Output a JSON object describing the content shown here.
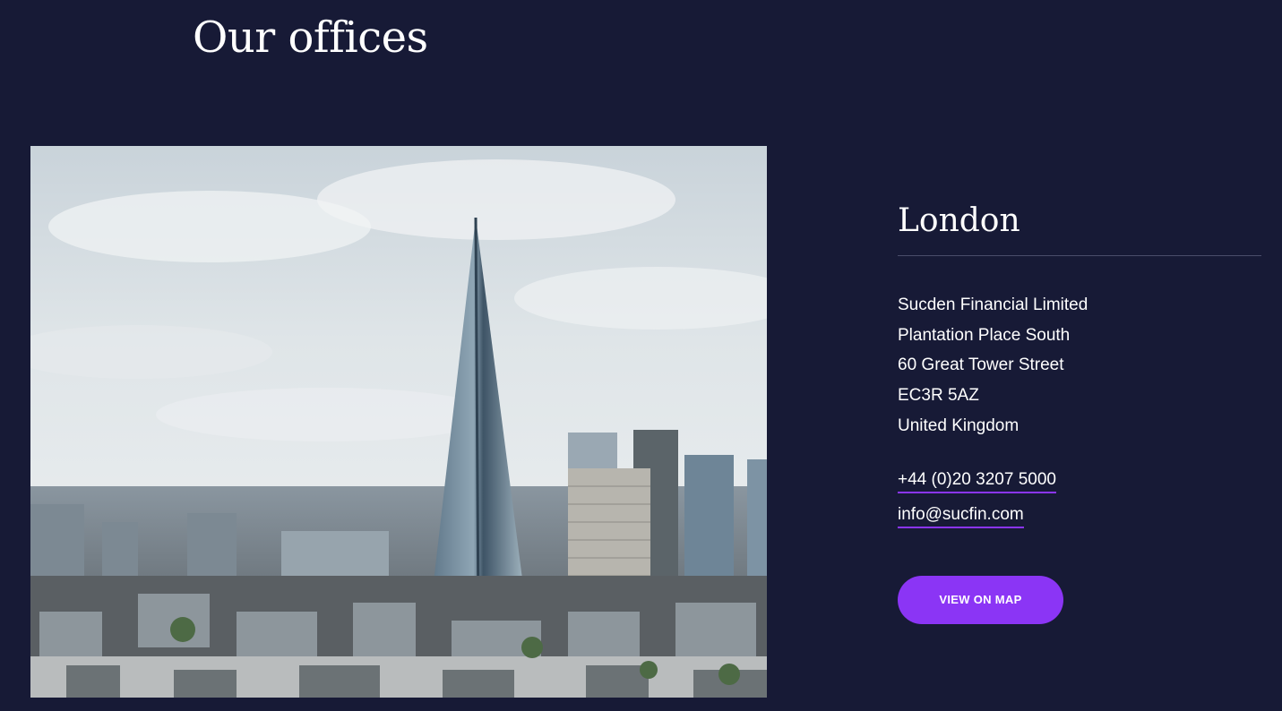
{
  "section": {
    "title": "Our offices"
  },
  "office": {
    "city": "London",
    "address_lines": [
      "Sucden Financial Limited",
      "Plantation Place South",
      "60 Great Tower Street",
      "EC3R 5AZ",
      "United Kingdom"
    ],
    "phone": "+44 (0)20 3207 5000",
    "email": "info@sucfin.com",
    "map_button_label": "VIEW ON MAP"
  },
  "colors": {
    "background": "#171a36",
    "accent": "#8b35f5",
    "text": "#ffffff"
  }
}
